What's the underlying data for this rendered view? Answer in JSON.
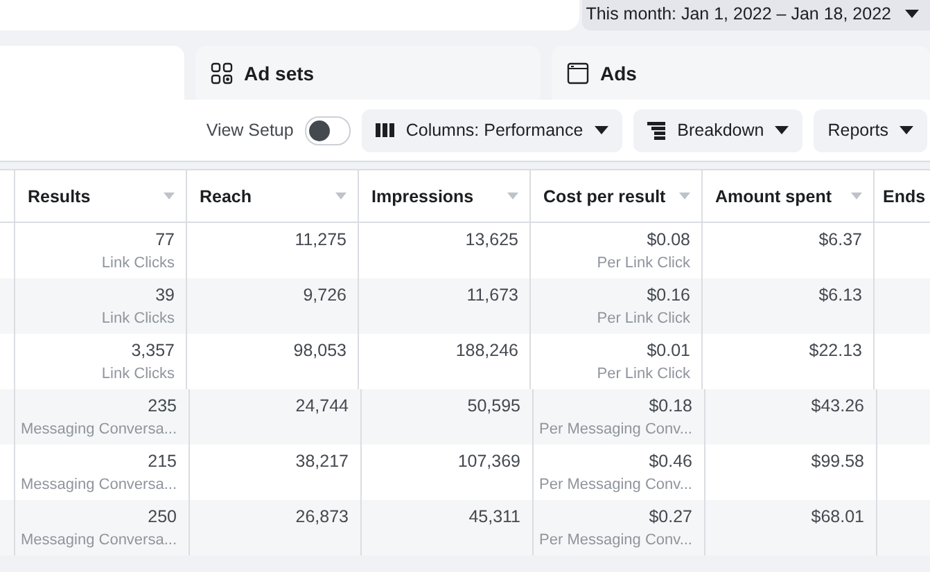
{
  "date_range": {
    "label": "This month: Jan 1, 2022 – Jan 18, 2022"
  },
  "tabs": [
    {
      "label": "Ad sets",
      "selected": false,
      "kind": "adsets"
    },
    {
      "label": "Ads",
      "selected": false,
      "kind": "ads"
    }
  ],
  "toolbar": {
    "view_setup": {
      "label": "View Setup",
      "on": false
    },
    "buttons": [
      {
        "label": "Columns: Performance",
        "kind": "columns"
      },
      {
        "label": "Breakdown",
        "kind": "breakdown"
      },
      {
        "label": "Reports",
        "kind": "none"
      }
    ]
  },
  "table": {
    "columns": [
      "Results",
      "Reach",
      "Impressions",
      "Cost per result",
      "Amount spent",
      "Ends"
    ],
    "rows": [
      {
        "results": "77",
        "results_note": "Link Clicks",
        "reach": "11,275",
        "impressions": "13,625",
        "cost": "$0.08",
        "cost_note": "Per Link Click",
        "spent": "$6.37"
      },
      {
        "results": "39",
        "results_note": "Link Clicks",
        "reach": "9,726",
        "impressions": "11,673",
        "cost": "$0.16",
        "cost_note": "Per Link Click",
        "spent": "$6.13"
      },
      {
        "results": "3,357",
        "results_note": "Link Clicks",
        "reach": "98,053",
        "impressions": "188,246",
        "cost": "$0.01",
        "cost_note": "Per Link Click",
        "spent": "$22.13"
      },
      {
        "results": "235",
        "results_note": "Messaging Conversa...",
        "reach": "24,744",
        "impressions": "50,595",
        "cost": "$0.18",
        "cost_note": "Per Messaging Conv...",
        "spent": "$43.26"
      },
      {
        "results": "215",
        "results_note": "Messaging Conversa...",
        "reach": "38,217",
        "impressions": "107,369",
        "cost": "$0.46",
        "cost_note": "Per Messaging Conv...",
        "spent": "$99.58"
      },
      {
        "results": "250",
        "results_note": "Messaging Conversa...",
        "reach": "26,873",
        "impressions": "45,311",
        "cost": "$0.27",
        "cost_note": "Per Messaging Conv...",
        "spent": "$68.01"
      }
    ]
  }
}
